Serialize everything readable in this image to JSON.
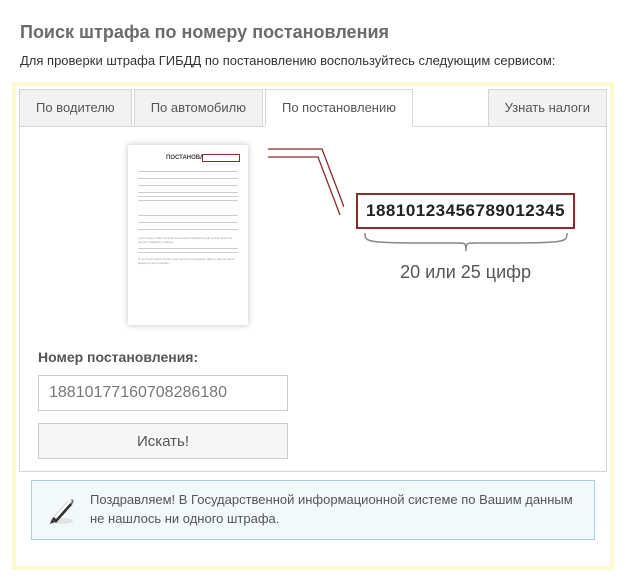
{
  "title": "Поиск штрафа по номеру постановления",
  "subtitle": "Для проверки штрафа ГИБДД по постановлению воспользуйтесь следующим сервисом:",
  "tabs": {
    "driver": "По водителю",
    "car": "По автомобилю",
    "resolution": "По постановлению",
    "taxes": "Узнать налоги"
  },
  "illustration": {
    "doc_label": "ПОСТАНОВЛЕНИЕ",
    "example_number": "18810123456789012345",
    "hint": "20 или 25 цифр"
  },
  "form": {
    "label": "Номер постановления:",
    "value": "18810177160708286180",
    "submit": "Искать!"
  },
  "result": {
    "text": "Поздравляем! В Государственной информационной системе по Вашим данным не нашлось ни одного штрафа."
  }
}
